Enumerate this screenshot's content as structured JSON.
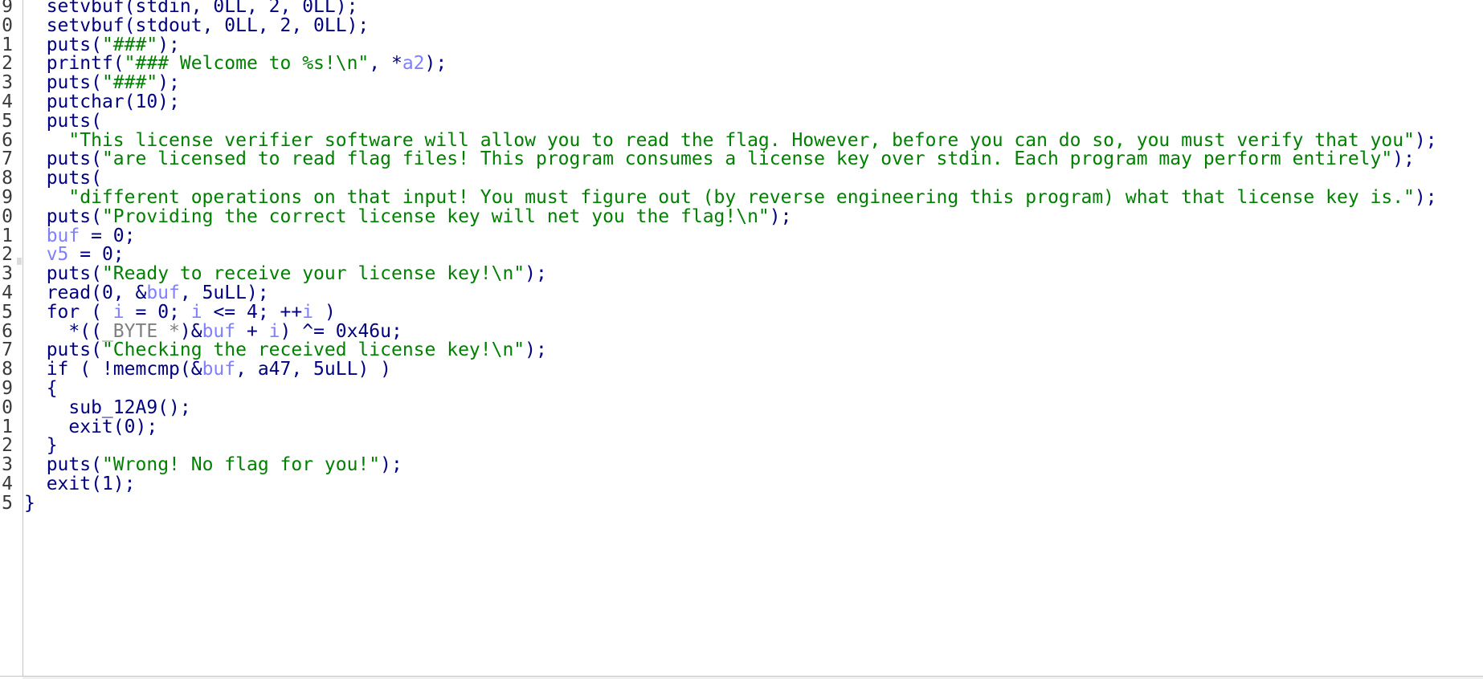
{
  "editor": {
    "colors": {
      "background": "#ffffff",
      "keyword_and_function": "#000080",
      "string_literal": "#008000",
      "variable": "#8080ff",
      "type_name": "#808080",
      "line_number": "#3a3a3a",
      "gutter_border": "#c4c4c4"
    },
    "lines": [
      {
        "number": "9",
        "indent": "  ",
        "tokens": [
          {
            "t": "setvbuf(stdin, 0LL, 2, 0LL);",
            "k": "p"
          }
        ]
      },
      {
        "number": "0",
        "indent": "  ",
        "tokens": [
          {
            "t": "setvbuf(stdout, 0LL, 2, 0LL);",
            "k": "p"
          }
        ]
      },
      {
        "number": "1",
        "indent": "  ",
        "tokens": [
          {
            "t": "puts(",
            "k": "p"
          },
          {
            "t": "\"###\"",
            "k": "s"
          },
          {
            "t": ");",
            "k": "p"
          }
        ]
      },
      {
        "number": "2",
        "indent": "  ",
        "tokens": [
          {
            "t": "printf(",
            "k": "p"
          },
          {
            "t": "\"### Welcome to %s!\\n\"",
            "k": "s"
          },
          {
            "t": ", *",
            "k": "p"
          },
          {
            "t": "a2",
            "k": "v"
          },
          {
            "t": ");",
            "k": "p"
          }
        ]
      },
      {
        "number": "3",
        "indent": "  ",
        "tokens": [
          {
            "t": "puts(",
            "k": "p"
          },
          {
            "t": "\"###\"",
            "k": "s"
          },
          {
            "t": ");",
            "k": "p"
          }
        ]
      },
      {
        "number": "4",
        "indent": "  ",
        "tokens": [
          {
            "t": "putchar(10);",
            "k": "p"
          }
        ]
      },
      {
        "number": "5",
        "indent": "  ",
        "tokens": [
          {
            "t": "puts(",
            "k": "p"
          }
        ]
      },
      {
        "number": "6",
        "indent": "    ",
        "tokens": [
          {
            "t": "\"This license verifier software will allow you to read the flag. However, before you can do so, you must verify that you\"",
            "k": "s"
          },
          {
            "t": ");",
            "k": "p"
          }
        ]
      },
      {
        "number": "7",
        "indent": "  ",
        "tokens": [
          {
            "t": "puts(",
            "k": "p"
          },
          {
            "t": "\"are licensed to read flag files! This program consumes a license key over stdin. Each program may perform entirely\"",
            "k": "s"
          },
          {
            "t": ");",
            "k": "p"
          }
        ]
      },
      {
        "number": "8",
        "indent": "  ",
        "tokens": [
          {
            "t": "puts(",
            "k": "p"
          }
        ]
      },
      {
        "number": "9",
        "indent": "    ",
        "tokens": [
          {
            "t": "\"different operations on that input! You must figure out (by reverse engineering this program) what that license key is.\"",
            "k": "s"
          },
          {
            "t": ");",
            "k": "p"
          }
        ]
      },
      {
        "number": "0",
        "indent": "  ",
        "tokens": [
          {
            "t": "puts(",
            "k": "p"
          },
          {
            "t": "\"Providing the correct license key will net you the flag!\\n\"",
            "k": "s"
          },
          {
            "t": ");",
            "k": "p"
          }
        ]
      },
      {
        "number": "1",
        "indent": "  ",
        "tokens": [
          {
            "t": "buf",
            "k": "v"
          },
          {
            "t": " = 0;",
            "k": "p"
          }
        ]
      },
      {
        "number": "2",
        "indent": "  ",
        "tokens": [
          {
            "t": "v5",
            "k": "v"
          },
          {
            "t": " = 0;",
            "k": "p"
          }
        ]
      },
      {
        "number": "3",
        "indent": "  ",
        "tokens": [
          {
            "t": "puts(",
            "k": "p"
          },
          {
            "t": "\"Ready to receive your license key!\\n\"",
            "k": "s"
          },
          {
            "t": ");",
            "k": "p"
          }
        ]
      },
      {
        "number": "4",
        "indent": "  ",
        "tokens": [
          {
            "t": "read(0, &",
            "k": "p"
          },
          {
            "t": "buf",
            "k": "v"
          },
          {
            "t": ", 5uLL);",
            "k": "p"
          }
        ]
      },
      {
        "number": "5",
        "indent": "  ",
        "tokens": [
          {
            "t": "for ( ",
            "k": "p"
          },
          {
            "t": "i",
            "k": "v"
          },
          {
            "t": " = 0; ",
            "k": "p"
          },
          {
            "t": "i",
            "k": "v"
          },
          {
            "t": " <= 4; ++",
            "k": "p"
          },
          {
            "t": "i",
            "k": "v"
          },
          {
            "t": " )",
            "k": "p"
          }
        ]
      },
      {
        "number": "6",
        "indent": "    ",
        "tokens": [
          {
            "t": "*((",
            "k": "p"
          },
          {
            "t": "_BYTE *",
            "k": "g"
          },
          {
            "t": ")&",
            "k": "p"
          },
          {
            "t": "buf",
            "k": "v"
          },
          {
            "t": " + ",
            "k": "p"
          },
          {
            "t": "i",
            "k": "v"
          },
          {
            "t": ") ^= 0x46u;",
            "k": "p"
          }
        ]
      },
      {
        "number": "7",
        "indent": "  ",
        "tokens": [
          {
            "t": "puts(",
            "k": "p"
          },
          {
            "t": "\"Checking the received license key!\\n\"",
            "k": "s"
          },
          {
            "t": ");",
            "k": "p"
          }
        ]
      },
      {
        "number": "8",
        "indent": "  ",
        "tokens": [
          {
            "t": "if ( !memcmp(&",
            "k": "p"
          },
          {
            "t": "buf",
            "k": "v"
          },
          {
            "t": ", a47, 5uLL) )",
            "k": "p"
          }
        ]
      },
      {
        "number": "9",
        "indent": "  ",
        "tokens": [
          {
            "t": "{",
            "k": "p"
          }
        ]
      },
      {
        "number": "0",
        "indent": "    ",
        "tokens": [
          {
            "t": "sub_12A9();",
            "k": "p"
          }
        ]
      },
      {
        "number": "1",
        "indent": "    ",
        "tokens": [
          {
            "t": "exit(0);",
            "k": "p"
          }
        ]
      },
      {
        "number": "2",
        "indent": "  ",
        "tokens": [
          {
            "t": "}",
            "k": "p"
          }
        ]
      },
      {
        "number": "3",
        "indent": "  ",
        "tokens": [
          {
            "t": "puts(",
            "k": "p"
          },
          {
            "t": "\"Wrong! No flag for you!\"",
            "k": "s"
          },
          {
            "t": ");",
            "k": "p"
          }
        ]
      },
      {
        "number": "4",
        "indent": "  ",
        "tokens": [
          {
            "t": "exit(1);",
            "k": "p"
          }
        ]
      },
      {
        "number": "5",
        "indent": "",
        "tokens": [
          {
            "t": "}",
            "k": "p"
          }
        ]
      }
    ]
  }
}
